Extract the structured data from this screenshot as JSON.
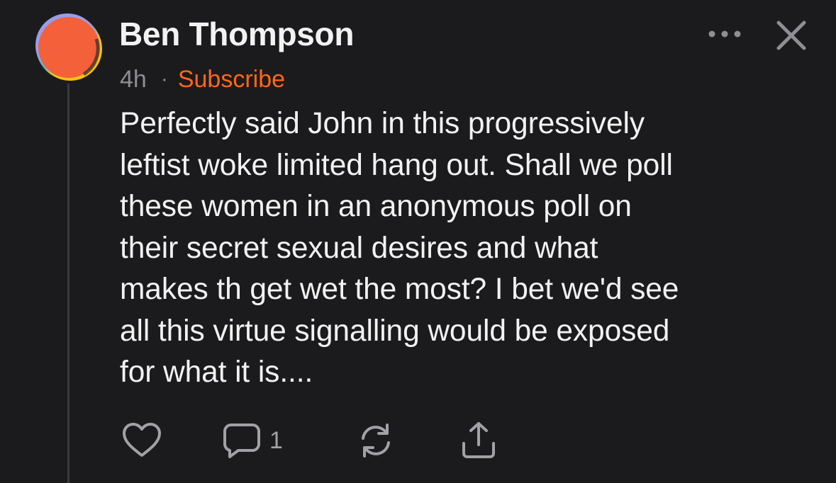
{
  "comment": {
    "author": "Ben Thompson",
    "timestamp": "4h",
    "separator": "·",
    "subscribe_label": "Subscribe",
    "body_lines": [
      "Perfectly said John in this progressively",
      "leftist woke limited hang out. Shall we poll",
      "these women in an anonymous poll on",
      "their secret sexual desires and what",
      "makes th get wet the most? I bet we'd see",
      "all this virtue signalling would be exposed",
      "for what it is...."
    ]
  },
  "header_actions": {
    "more_icon": "more-horizontal-icon",
    "close_icon": "close-icon"
  },
  "actions": {
    "like_icon": "heart-icon",
    "comment_icon": "comment-icon",
    "comment_count": "1",
    "restack_icon": "restack-icon",
    "share_icon": "share-icon"
  },
  "colors": {
    "background": "#1b1b1d",
    "text": "#f2f2f2",
    "muted": "#8e8e93",
    "accent": "#ff6719"
  }
}
